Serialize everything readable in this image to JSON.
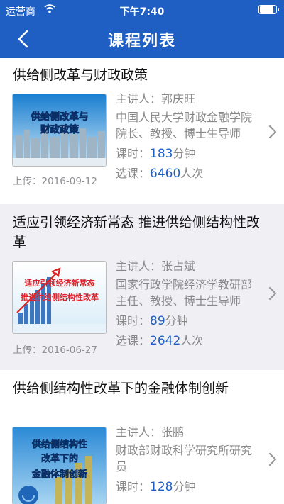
{
  "status_bar": {
    "carrier": "运营商",
    "time": "下午7:40",
    "battery_level": 0.95
  },
  "nav": {
    "title": "课程列表"
  },
  "courses": [
    {
      "title": "供给侧改革与财政政策",
      "thumb_lines": [
        "供给侧改革与",
        "财政政策"
      ],
      "speaker_label": "主讲人：",
      "speaker": "郭庆旺",
      "speaker_desc": "中国人民大学财政金融学院院长、教授、博士生导师",
      "duration_label": "课时：",
      "duration": "183",
      "duration_unit": "分钟",
      "enroll_label": "选课：",
      "enroll": "6460",
      "enroll_unit": "人次",
      "upload": "上传：2016-09-12"
    },
    {
      "title": "适应引领经济新常态 推进供给侧结构性改革",
      "thumb_lines": [
        "适应引领经济新常态",
        "推进供给侧结构性改革"
      ],
      "speaker_label": "主讲人：",
      "speaker": "张占斌",
      "speaker_desc": "国家行政学院经济学教研部主任、教授、博士生导师",
      "duration_label": "课时：",
      "duration": "89",
      "duration_unit": "分钟",
      "enroll_label": "选课：",
      "enroll": "2642",
      "enroll_unit": "人次",
      "upload": "上传：2016-06-27"
    },
    {
      "title": "供给侧结构性改革下的金融体制创新",
      "thumb_lines": [
        "供给侧结构性",
        "改革下的",
        "金融体制创新"
      ],
      "speaker_label": "主讲人：",
      "speaker": "张鹏",
      "speaker_desc": "财政部财政科学研究所研究员",
      "duration_label": "课时：",
      "duration": "128",
      "duration_unit": "分钟"
    }
  ],
  "colors": {
    "primary": "#1f5fc4",
    "alt_row": "#efeff4",
    "card": "#ffffff"
  }
}
